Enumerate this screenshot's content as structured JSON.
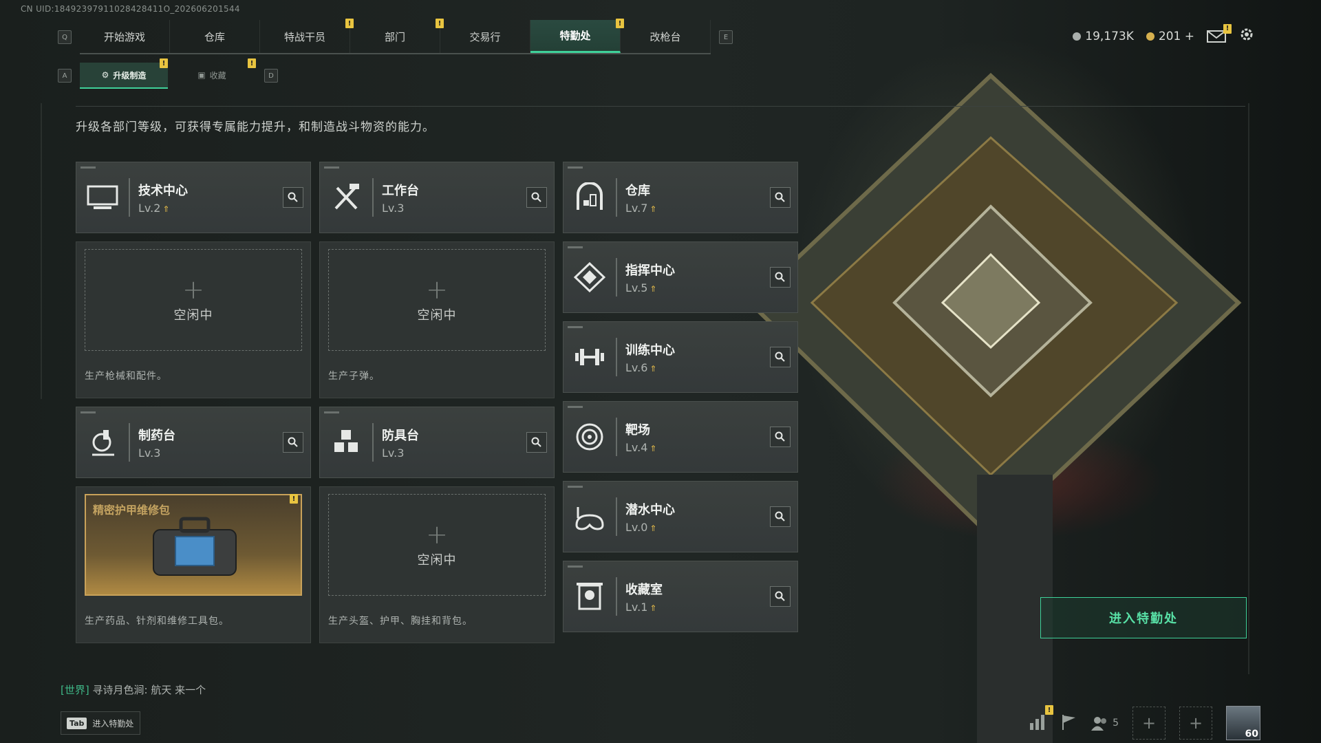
{
  "uid": "CN UID:18492397911028428411O_202606201544",
  "nav": {
    "left_key": "Q",
    "right_key": "E",
    "tabs": [
      {
        "label": "开始游戏"
      },
      {
        "label": "仓库"
      },
      {
        "label": "特战干员"
      },
      {
        "label": "部门"
      },
      {
        "label": "交易行"
      },
      {
        "label": "特勤处"
      },
      {
        "label": "改枪台"
      }
    ],
    "active_index": 5
  },
  "subnav": {
    "left_key": "A",
    "right_key": "D",
    "tabs": [
      {
        "label": "升级制造"
      },
      {
        "label": "收藏"
      }
    ]
  },
  "currency": {
    "silver": "19,173K",
    "gold": "201",
    "gold_add": "+"
  },
  "description": "升级各部门等级，可获得专属能力提升，和制造战斗物资的能力。",
  "facilities": {
    "tech": {
      "name": "技术中心",
      "level": "Lv.2",
      "idle": "空闲中",
      "plus": "+",
      "footer": "生产枪械和配件。"
    },
    "workbench": {
      "name": "工作台",
      "level": "Lv.3",
      "idle": "空闲中",
      "plus": "+",
      "footer": "生产子弹。"
    },
    "pharma": {
      "name": "制药台",
      "level": "Lv.3",
      "product": "精密护甲维修包",
      "footer": "生产药品、针剂和维修工具包。"
    },
    "armor": {
      "name": "防具台",
      "level": "Lv.3",
      "idle": "空闲中",
      "plus": "+",
      "footer": "生产头盔、护甲、胸挂和背包。"
    },
    "warehouse": {
      "name": "仓库",
      "level": "Lv.7"
    },
    "command": {
      "name": "指挥中心",
      "level": "Lv.5"
    },
    "training": {
      "name": "训练中心",
      "level": "Lv.6"
    },
    "range": {
      "name": "靶场",
      "level": "Lv.4"
    },
    "diving": {
      "name": "潜水中心",
      "level": "Lv.0"
    },
    "collection": {
      "name": "收藏室",
      "level": "Lv.1"
    }
  },
  "enter_button": "进入特勤处",
  "chat": {
    "channel": "[世界]",
    "user": "寻诗月色涧:",
    "message": "航天 来一个"
  },
  "tab_hint": {
    "key": "Tab",
    "label": "进入特勤处"
  },
  "bottom": {
    "friends_count": "5",
    "player_level": "60"
  },
  "icons": {
    "search": "search-icon",
    "settings": "gear-icon",
    "mail": "mail-icon"
  },
  "colors": {
    "accent": "#3fd29a",
    "badge": "#e8c440",
    "upgrade": "#e0b84a"
  }
}
